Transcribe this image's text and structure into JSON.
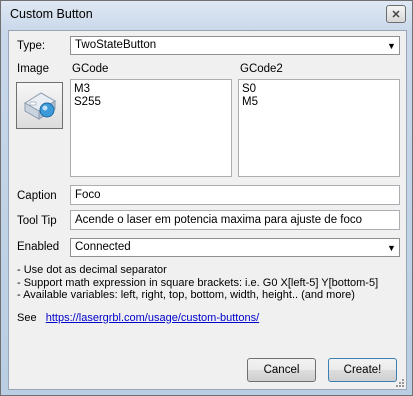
{
  "window": {
    "title": "Custom Button",
    "close_glyph": "✕"
  },
  "type": {
    "label": "Type:",
    "value": "TwoStateButton"
  },
  "image": {
    "label": "Image",
    "icon": "laser-button-icon"
  },
  "gcode": {
    "label": "GCode",
    "lines": [
      "M3",
      "S255"
    ]
  },
  "gcode2": {
    "label": "GCode2",
    "lines": [
      "S0",
      "M5"
    ]
  },
  "caption": {
    "label": "Caption",
    "value": "Foco"
  },
  "tooltip": {
    "label": "Tool Tip",
    "value": "Acende o laser em potencia maxima para ajuste de foco"
  },
  "enabled": {
    "label": "Enabled",
    "value": "Connected"
  },
  "help": {
    "lines": [
      "- Use dot as decimal separator",
      "- Support math expression in square brackets: i.e. G0 X[left-5] Y[bottom-5]",
      "- Available variables: left, right, top, bottom, width, height.. (and more)"
    ],
    "see_label": "See",
    "link": "https://lasergrbl.com/usage/custom-buttons/"
  },
  "buttons": {
    "cancel": "Cancel",
    "create": "Create!"
  }
}
